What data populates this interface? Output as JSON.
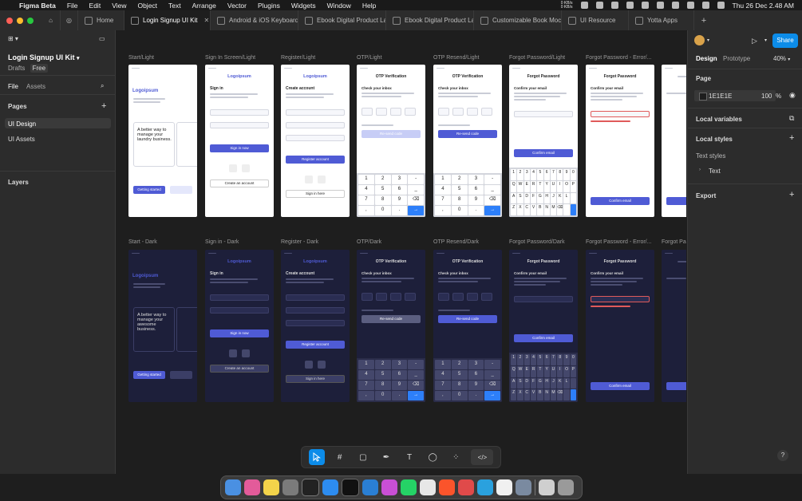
{
  "menubar": {
    "app_name": "Figma Beta",
    "items": [
      "File",
      "Edit",
      "View",
      "Object",
      "Text",
      "Arrange",
      "Vector",
      "Plugins",
      "Widgets",
      "Window",
      "Help"
    ],
    "net_up": "0 KB/s",
    "net_down": "0 KB/s",
    "datetime": "Thu 26 Dec  2.48 AM"
  },
  "tabs": [
    {
      "label": "Home"
    },
    {
      "label": "Login Signup UI Kit",
      "active": true
    },
    {
      "label": "Android & iOS Keyboard li"
    },
    {
      "label": "Ebook Digital Product Lar"
    },
    {
      "label": "Ebook Digital Product Lar"
    },
    {
      "label": "Customizable Book Mock"
    },
    {
      "label": "UI Resource"
    },
    {
      "label": "Yotta Apps"
    }
  ],
  "left_panel": {
    "file_title": "Login Signup UI Kit",
    "drafts": "Drafts",
    "plan_badge": "Free",
    "tab_file": "File",
    "tab_assets": "Assets",
    "pages_heading": "Pages",
    "pages": [
      "UI Design",
      "UI Assets"
    ],
    "layers_heading": "Layers"
  },
  "right_panel": {
    "tab_design": "Design",
    "tab_prototype": "Prototype",
    "zoom": "40%",
    "share_label": "Share",
    "page_heading": "Page",
    "page_color": "1E1E1E",
    "page_opacity": "100",
    "percent_sign": "%",
    "local_variables": "Local variables",
    "local_styles": "Local styles",
    "text_styles": "Text styles",
    "text_style_item": "Text",
    "export": "Export",
    "help": "?"
  },
  "canvas": {
    "light_frames": [
      {
        "label": "Start/Light",
        "kind": "start"
      },
      {
        "label": "Sign In Screen/Light",
        "kind": "signin"
      },
      {
        "label": "Register/Light",
        "kind": "register"
      },
      {
        "label": "OTP/Light",
        "kind": "otp"
      },
      {
        "label": "OTP Resend/Light",
        "kind": "otpresend"
      },
      {
        "label": "Forgot Password/Light",
        "kind": "forgot"
      },
      {
        "label": "Forgot Password - Error/...",
        "kind": "forgoterr"
      },
      {
        "label": "",
        "kind": "partial"
      }
    ],
    "dark_frames": [
      {
        "label": "Start - Dark",
        "kind": "start"
      },
      {
        "label": "Sign in - Dark",
        "kind": "signin"
      },
      {
        "label": "Register - Dark",
        "kind": "register"
      },
      {
        "label": "OTP/Dark",
        "kind": "otp"
      },
      {
        "label": "OTP Resend/Dark",
        "kind": "otpresend"
      },
      {
        "label": "Forgot Password/Dark",
        "kind": "forgot"
      },
      {
        "label": "Forgot Password - Error/...",
        "kind": "forgoterr"
      },
      {
        "label": "Forgot Pas",
        "kind": "partial"
      }
    ],
    "screen_text": {
      "logo": "Logoipsum",
      "sign_in": "Sign in",
      "sign_in_btn": "Sign in now",
      "create_account": "Create account",
      "register_btn": "Register account",
      "create_account_btn": "Create an account",
      "sign_in_here": "Sign in here",
      "otp_title": "OTP Verification",
      "check_inbox": "Check your inbox",
      "resend": "Re-send code",
      "forgot_title": "Forgot Password",
      "confirm_email_title": "Confirm your email",
      "confirm_btn": "Confirm email",
      "tagline": "A better way to manage your laundry business.",
      "tagline_dark": "A better way to manage your awesome business.",
      "get_started": "Getting started"
    },
    "numpad": [
      "1",
      "2",
      "3",
      "-",
      "4",
      "5",
      "6",
      "_",
      "7",
      "8",
      "9",
      "⌫",
      ",",
      "0",
      ".",
      "→"
    ],
    "qwerty": [
      "1",
      "2",
      "3",
      "4",
      "5",
      "6",
      "7",
      "8",
      "9",
      "0",
      "Q",
      "W",
      "E",
      "R",
      "T",
      "Y",
      "U",
      "I",
      "O",
      "P",
      "A",
      "S",
      "D",
      "F",
      "G",
      "H",
      "J",
      "K",
      "L",
      "",
      "Z",
      "X",
      "C",
      "V",
      "B",
      "N",
      "M",
      "⌫",
      "",
      ""
    ]
  },
  "toolbar": {
    "tools": [
      "move-tool",
      "frame-tool",
      "shape-tool",
      "pen-tool",
      "text-tool",
      "comment-tool",
      "components-tool",
      "dev-mode-toggle"
    ]
  },
  "colors": {
    "canvas_bg": "#1e1e1e",
    "panel_bg": "#2c2c2c",
    "accent": "#0c8ce9",
    "brand_button": "#4f5bd5",
    "dark_frame_bg": "#1d1f3a"
  }
}
